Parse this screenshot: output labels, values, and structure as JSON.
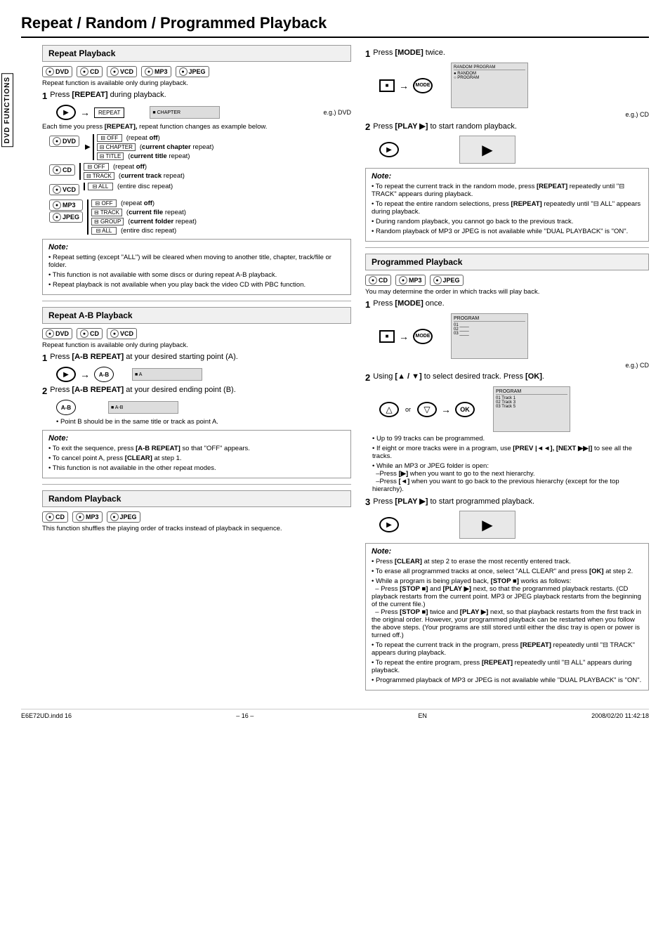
{
  "title": "Repeat / Random / Programmed Playback",
  "vertical_label": "DVD FUNCTIONS",
  "sections": {
    "repeat_playback": {
      "heading": "Repeat Playback",
      "discs": [
        "DVD",
        "CD",
        "VCD",
        "MP3",
        "JPEG"
      ],
      "availability": "Repeat function is available only during playback.",
      "step1": {
        "num": "1",
        "text": "Press [REPEAT] during playback.",
        "diagram_label": "e.g.) DVD"
      },
      "each_press_text": "Each time you press [REPEAT], repeat function changes as example below.",
      "dvd_options": {
        "disc": "DVD",
        "options": [
          {
            "icon": "OFF",
            "desc": "(repeat off)"
          },
          {
            "icon": "CHAPTER",
            "desc": "(current chapter repeat)"
          },
          {
            "icon": "TITLE",
            "desc": "(current title repeat)"
          }
        ]
      },
      "cd_options": {
        "disc": "CD",
        "options": [
          {
            "icon": "OFF",
            "desc": "(repeat off)"
          },
          {
            "icon": "TRACK",
            "desc": "(current track repeat)"
          }
        ]
      },
      "vcd_options": {
        "disc": "VCD",
        "options": [
          {
            "icon": "ALL",
            "desc": "(entire disc repeat)"
          }
        ]
      },
      "mp3_jpeg_options": {
        "disc": "MP3/JPEG",
        "options": [
          {
            "icon": "OFF",
            "desc": "(repeat off)"
          },
          {
            "icon": "TRACK",
            "desc": "(current file repeat)"
          },
          {
            "icon": "GROUP",
            "desc": "(current folder repeat)"
          },
          {
            "icon": "ALL",
            "desc": "(entire disc repeat)"
          }
        ]
      },
      "note": {
        "title": "Note:",
        "items": [
          "Repeat setting (except \"ALL\") will be cleared when moving to another title, chapter, track/file or folder.",
          "This function is not available with some discs or during repeat A-B playback.",
          "Repeat playback is not available when you play back the video CD with PBC function."
        ]
      }
    },
    "repeat_ab": {
      "heading": "Repeat A-B Playback",
      "discs": [
        "DVD",
        "CD",
        "VCD"
      ],
      "availability": "Repeat function is available only during playback.",
      "step1": {
        "num": "1",
        "text": "Press [A-B REPEAT] at your desired starting point (A).",
        "diagram_label": "A"
      },
      "step2": {
        "num": "2",
        "text": "Press [A-B REPEAT] at your desired ending point (B).",
        "diagram_label": "A-B"
      },
      "point_b_note": "Point B should be in the same title or track as point A.",
      "note": {
        "title": "Note:",
        "items": [
          "To exit the sequence, press [A-B REPEAT] so that \"OFF\" appears.",
          "To cancel point A, press [CLEAR] at step 1.",
          "This function is not available in the other repeat modes."
        ]
      }
    },
    "random_playback": {
      "heading": "Random Playback",
      "discs": [
        "CD",
        "MP3",
        "JPEG"
      ],
      "intro": "This function shuffles the playing order of tracks instead of playback in sequence.",
      "step1": {
        "num": "1",
        "text": "Press [MODE] twice.",
        "diagram_label": "e.g.) CD"
      },
      "step2": {
        "num": "2",
        "text": "Press [PLAY ▶] to start random playback."
      },
      "note": {
        "title": "Note:",
        "items": [
          "To repeat the current track in the random mode, press [REPEAT] repeatedly until \"⊟ TRACK\" appears during playback.",
          "To repeat the entire random selections, press [REPEAT] repeatedly until \"⊟ ALL\" appears during playback.",
          "During random playback, you cannot go back to the previous track.",
          "Random playback of MP3 or JPEG is not available while \"DUAL PLAYBACK\" is \"ON\"."
        ]
      }
    },
    "programmed_playback": {
      "heading": "Programmed Playback",
      "discs": [
        "CD",
        "MP3",
        "JPEG"
      ],
      "intro": "You may determine the order in which tracks will play back.",
      "step1": {
        "num": "1",
        "text": "Press [MODE] once.",
        "diagram_label": "e.g.) CD"
      },
      "step2": {
        "num": "2",
        "text": "Using [▲ / ▼] to select desired track. Press [OK].",
        "notes": [
          "Up to 99 tracks can be programmed.",
          "If eight or more tracks were in a program, use [PREV |◄◄], [NEXT ▶▶|] to see all the tracks.",
          "While an MP3 or JPEG folder is open: –Press [▶] when you want to go to the next hierarchy. –Press [◄] when you want to go back to the previous hierarchy (except for the top hierarchy)."
        ]
      },
      "step3": {
        "num": "3",
        "text": "Press [PLAY ▶] to start programmed playback."
      },
      "note": {
        "title": "Note:",
        "items": [
          "Press [CLEAR] at step 2 to erase the most recently entered track.",
          "To erase all programmed tracks at once, select \"ALL CLEAR\" and press [OK] at step 2.",
          "While a program is being played back, [STOP ■] works as follows: –Press [STOP ■] and [PLAY ▶] next, so that the programmed playback restarts. (CD playback restarts from the current point. MP3 or JPEG playback restarts from the beginning of the current file.) –Press [STOP ■] twice and [PLAY ▶] next, so that playback restarts from the first track in the original order. However, your programmed playback can be restarted when you follow the above steps. (Your programs are still stored until either the disc tray is open or power is turned off.)",
          "To repeat the current track in the program, press [REPEAT] repeatedly until \"⊟ TRACK\" appears during playback.",
          "To repeat the entire program, press [REPEAT] repeatedly until \"⊟ ALL\" appears during playback.",
          "Programmed playback of MP3 or JPEG is not available while \"DUAL PLAYBACK\" is \"ON\"."
        ]
      }
    }
  },
  "footer": {
    "page": "– 16 –",
    "lang": "EN",
    "file_info": "E6E72UD.indd  16",
    "date_info": "2008/02/20  11:42:18"
  }
}
